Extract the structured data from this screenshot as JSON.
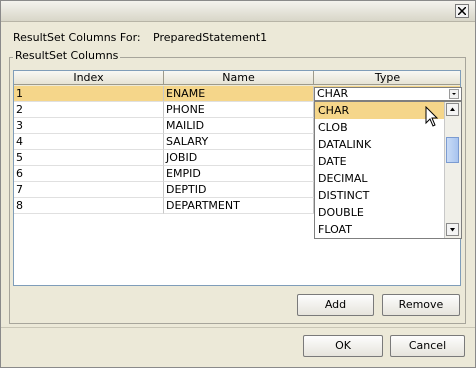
{
  "dialog": {
    "resultset_label": "ResultSet Columns For:",
    "resultset_name": "PreparedStatement1",
    "group_title": "ResultSet Columns"
  },
  "table": {
    "columns": [
      "Index",
      "Name",
      "Type"
    ],
    "rows": [
      {
        "index": "1",
        "name": "ENAME"
      },
      {
        "index": "2",
        "name": "PHONE"
      },
      {
        "index": "3",
        "name": "MAILID"
      },
      {
        "index": "4",
        "name": "SALARY"
      },
      {
        "index": "5",
        "name": "JOBID"
      },
      {
        "index": "6",
        "name": "EMPID"
      },
      {
        "index": "7",
        "name": "DEPTID"
      },
      {
        "index": "8",
        "name": "DEPARTMENT"
      }
    ],
    "selected_type": "CHAR"
  },
  "type_dropdown": {
    "options": [
      "CHAR",
      "CLOB",
      "DATALINK",
      "DATE",
      "DECIMAL",
      "DISTINCT",
      "DOUBLE",
      "FLOAT"
    ],
    "highlighted": "CHAR"
  },
  "buttons": {
    "add": "Add",
    "remove": "Remove",
    "ok": "OK",
    "cancel": "Cancel"
  },
  "colors": {
    "selection": "#f5d68a",
    "dialog_bg": "#ece9d8"
  }
}
